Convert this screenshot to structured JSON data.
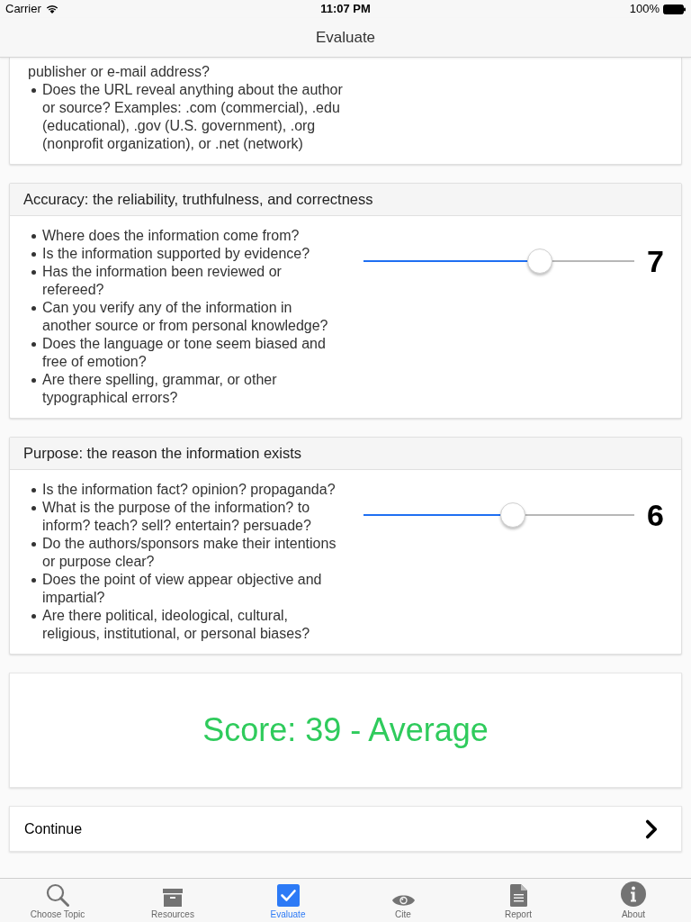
{
  "status_bar": {
    "carrier": "Carrier",
    "time": "11:07 PM",
    "battery": "100%"
  },
  "nav_bar": {
    "title": "Evaluate"
  },
  "sections": [
    {
      "continued_text": "publisher or e-mail address?",
      "items": [
        "Does the URL reveal anything about the author or source? Examples: .com (commercial), .edu (educational), .gov (U.S. government), .org (nonprofit organization), or .net (network)"
      ]
    },
    {
      "title": "Accuracy: the reliability, truthfulness, and correctness",
      "items": [
        "Where does the information come from?",
        "Is the information supported by evidence?",
        "Has the information been reviewed or refereed?",
        "Can you verify any of the information in another source or from personal knowledge?",
        "Does the language or tone seem biased and free of emotion?",
        "Are there spelling, grammar, or other typographical errors?"
      ],
      "slider": {
        "level": 0.667,
        "reading": "7"
      }
    },
    {
      "title": "Purpose: the reason the information exists",
      "items": [
        "Is the information fact? opinion? propaganda?",
        "What is the purpose of the information? to inform? teach? sell? entertain? persuade?",
        "Do the authors/sponsors make their intentions or purpose clear?",
        "Does the point of view appear objective and impartial?",
        "Are there political, ideological, cultural, religious, institutional, or personal biases?"
      ],
      "slider": {
        "level": 0.556,
        "reading": "6"
      }
    }
  ],
  "score": {
    "text": "Score: 39 - Average"
  },
  "continue_button": {
    "label": "Continue"
  },
  "tab_bar": [
    {
      "label": "Choose Topic",
      "selected": false
    },
    {
      "label": "Resources",
      "selected": false
    },
    {
      "label": "Evaluate",
      "selected": true
    },
    {
      "label": "Cite",
      "selected": false
    },
    {
      "label": "Report",
      "selected": false
    },
    {
      "label": "About",
      "selected": false
    }
  ]
}
